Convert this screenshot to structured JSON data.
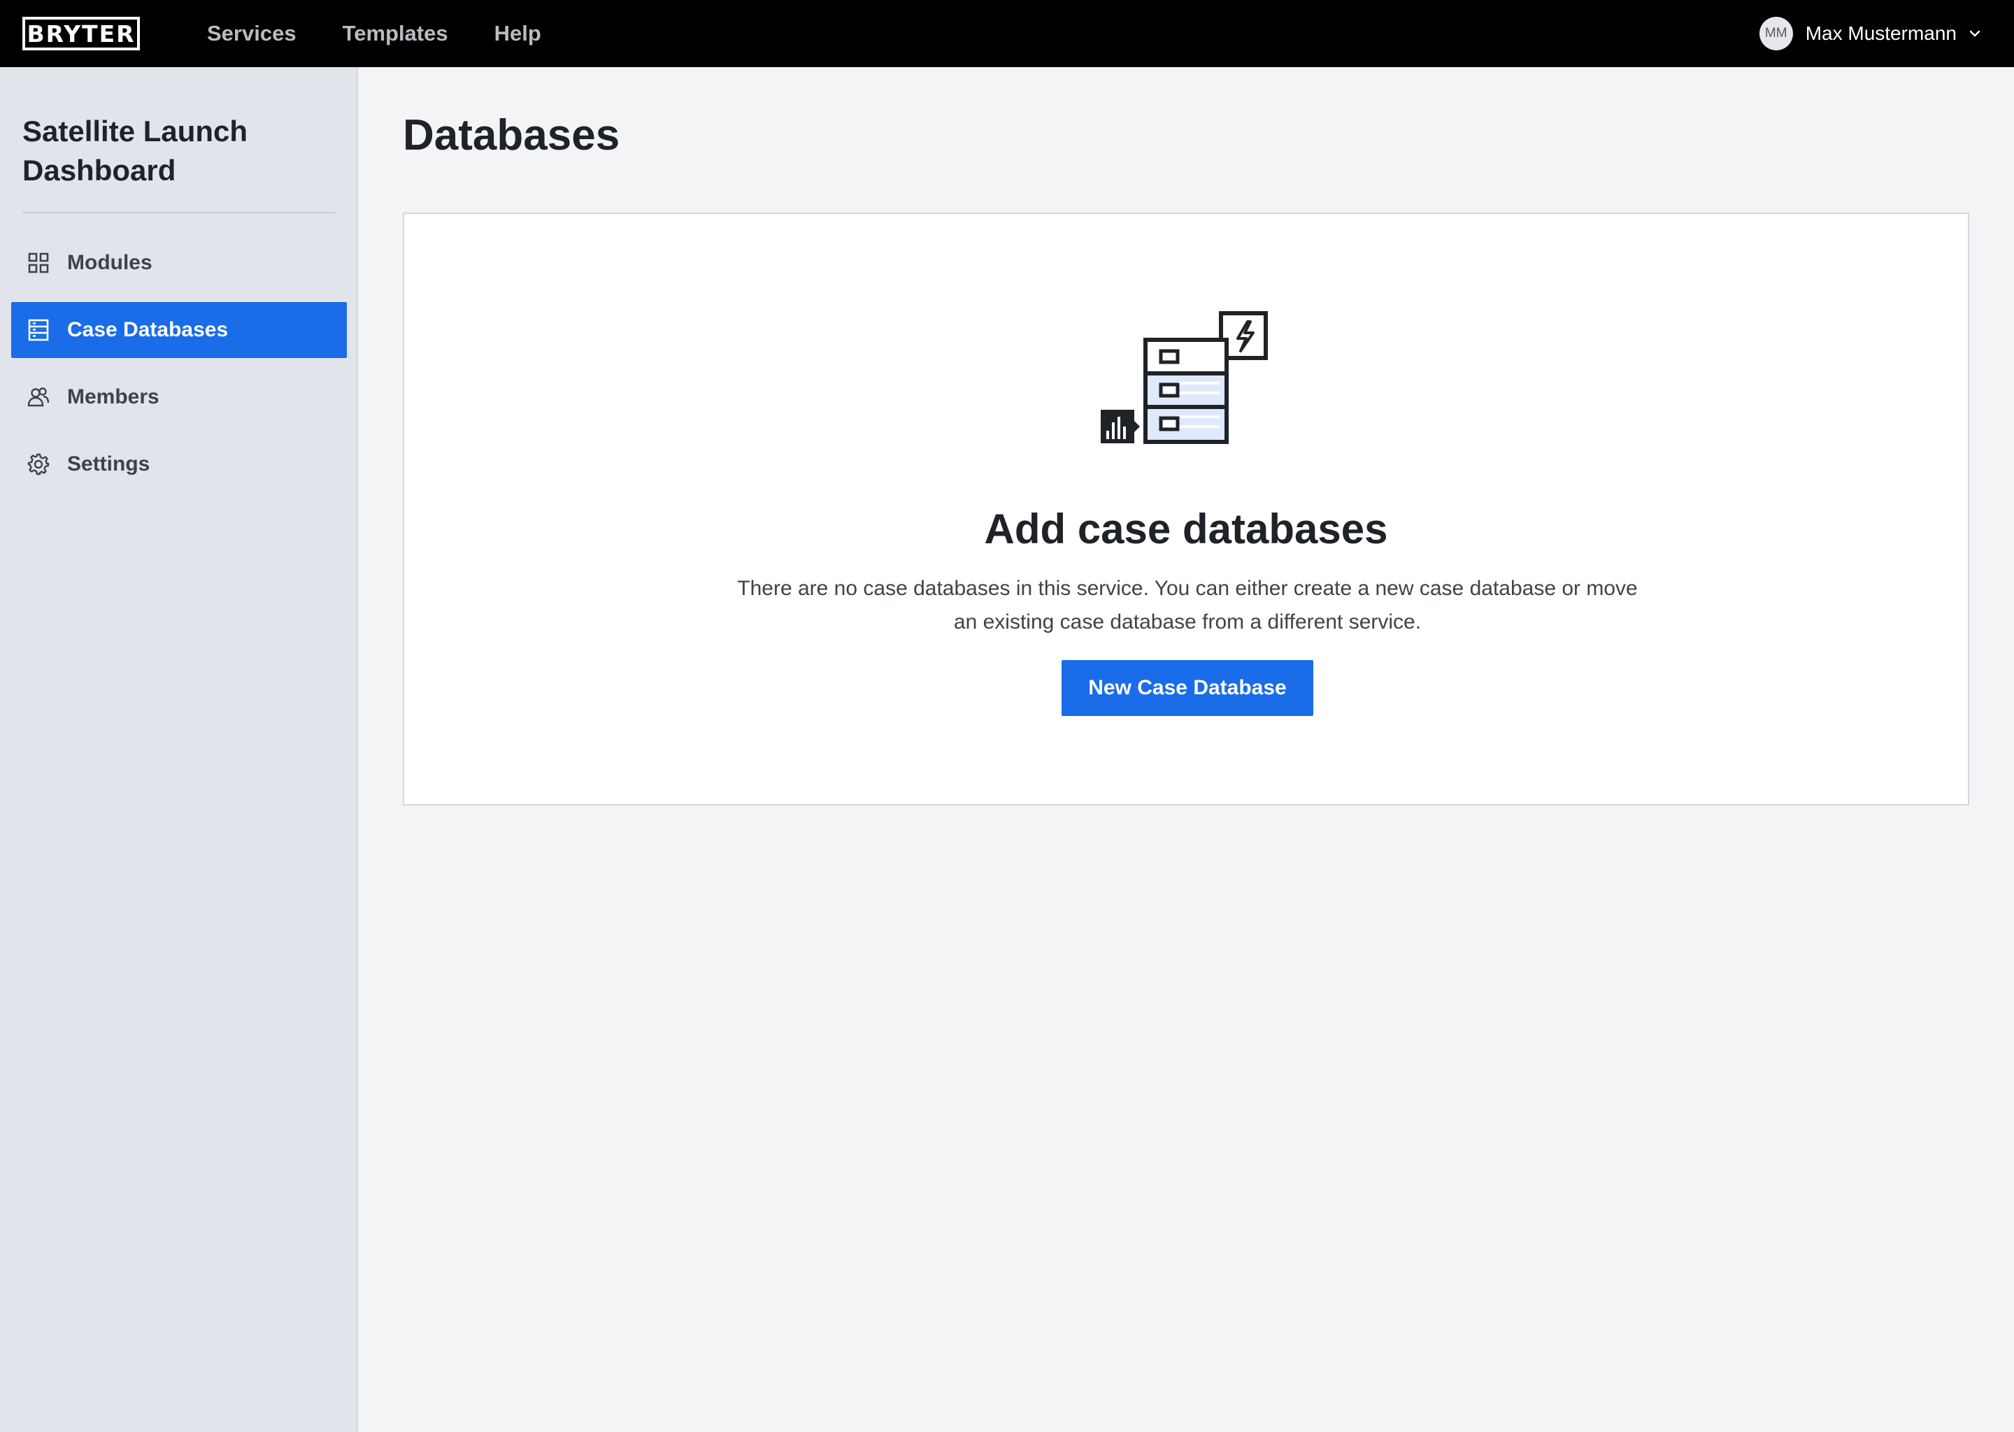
{
  "topbar": {
    "logo": "BRYTER",
    "nav": [
      "Services",
      "Templates",
      "Help"
    ],
    "user": {
      "initials": "MM",
      "name": "Max Mustermann"
    }
  },
  "sidebar": {
    "service_title": "Satellite Launch Dashboard",
    "items": [
      {
        "label": "Modules",
        "icon": "grid-icon",
        "active": false
      },
      {
        "label": "Case Databases",
        "icon": "database-icon",
        "active": true
      },
      {
        "label": "Members",
        "icon": "members-icon",
        "active": false
      },
      {
        "label": "Settings",
        "icon": "gear-icon",
        "active": false
      }
    ]
  },
  "main": {
    "title": "Databases",
    "empty_state": {
      "heading": "Add case databases",
      "text": "There are no case databases in this service. You can either create a new case database or move an existing case database from a different service.",
      "button_label": "New Case Database"
    }
  },
  "colors": {
    "accent": "#1a6ce8",
    "topbar_bg": "#000000",
    "sidebar_bg": "#e1e4ea",
    "page_bg": "#f3f4f6"
  }
}
